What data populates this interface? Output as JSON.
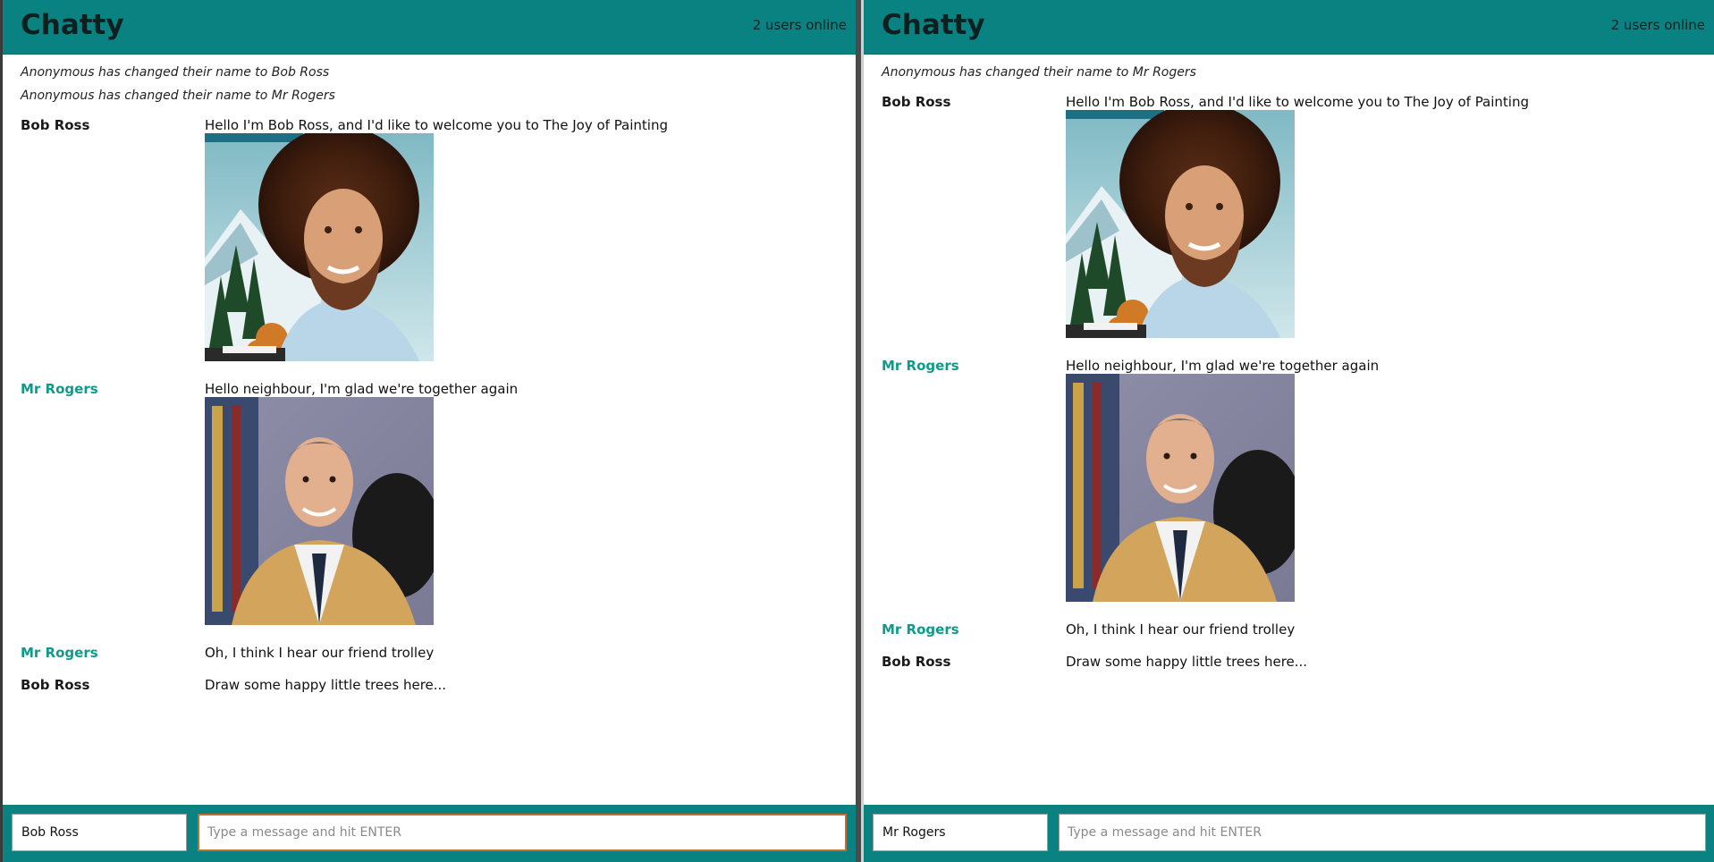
{
  "colors": {
    "accent": "#0b8282",
    "self_author": "#1a1a1a",
    "other_author": "#109a8a",
    "focus_border": "#c06f2c"
  },
  "left": {
    "title": "Chatty",
    "online": "2 users online",
    "notices": [
      "Anonymous has changed their name to Bob Ross",
      "Anonymous has changed their name to Mr Rogers"
    ],
    "messages": [
      {
        "author": "Bob Ross",
        "text": "Hello I'm Bob Ross, and I'd like to welcome you to The Joy of Painting",
        "image": "bob-ross-portrait"
      },
      {
        "author": "Mr Rogers",
        "text": "Hello neighbour, I'm glad we're together again",
        "image": "mr-rogers-portrait"
      },
      {
        "author": "Mr Rogers",
        "text": "Oh, I think I hear our friend trolley"
      },
      {
        "author": "Bob Ross",
        "text": "Draw some happy little trees here..."
      }
    ],
    "composer": {
      "name_value": "Bob Ross",
      "message_value": "",
      "message_placeholder": "Type a message and hit ENTER"
    }
  },
  "right": {
    "title": "Chatty",
    "online": "2 users online",
    "notices": [
      "Anonymous has changed their name to Mr Rogers"
    ],
    "messages": [
      {
        "author": "Bob Ross",
        "text": "Hello I'm Bob Ross, and I'd like to welcome you to The Joy of Painting",
        "image": "bob-ross-portrait"
      },
      {
        "author": "Mr Rogers",
        "text": "Hello neighbour, I'm glad we're together again",
        "image": "mr-rogers-portrait"
      },
      {
        "author": "Mr Rogers",
        "text": "Oh, I think I hear our friend trolley"
      },
      {
        "author": "Bob Ross",
        "text": "Draw some happy little trees here..."
      }
    ],
    "composer": {
      "name_value": "Mr Rogers",
      "message_value": "",
      "message_placeholder": "Type a message and hit ENTER"
    }
  }
}
